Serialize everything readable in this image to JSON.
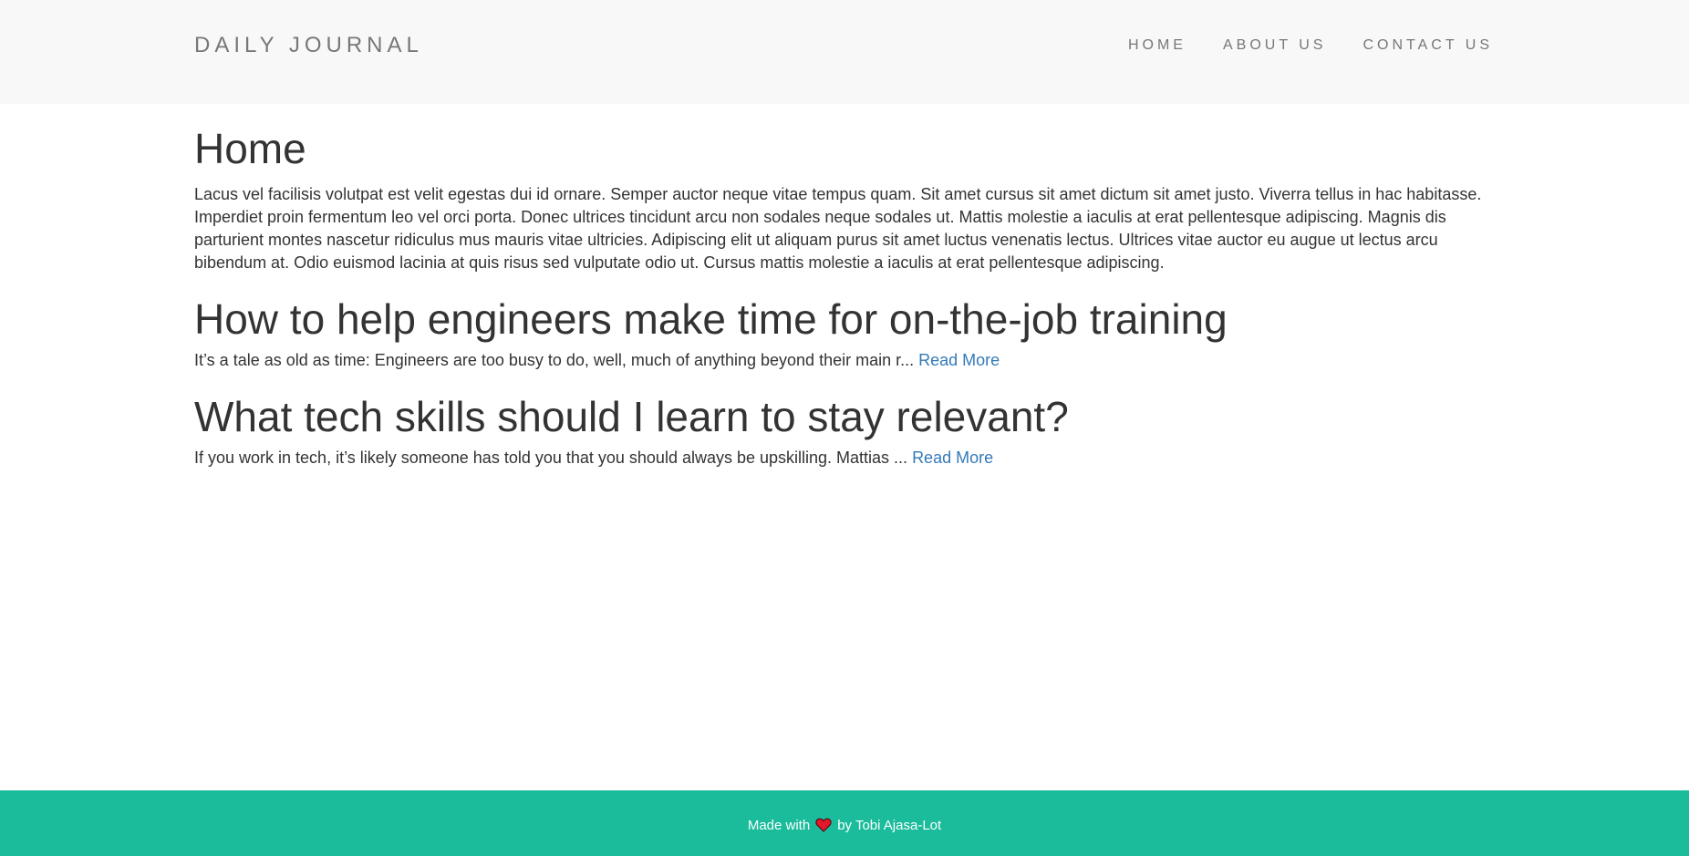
{
  "header": {
    "brand": "DAILY JOURNAL",
    "nav": [
      {
        "label": "HOME"
      },
      {
        "label": "ABOUT US"
      },
      {
        "label": "CONTACT US"
      }
    ]
  },
  "main": {
    "title": "Home",
    "intro": "Lacus vel facilisis volutpat est velit egestas dui id ornare. Semper auctor neque vitae tempus quam. Sit amet cursus sit amet dictum sit amet justo. Viverra tellus in hac habitasse. Imperdiet proin fermentum leo vel orci porta. Donec ultrices tincidunt arcu non sodales neque sodales ut. Mattis molestie a iaculis at erat pellentesque adipiscing. Magnis dis parturient montes nascetur ridiculus mus mauris vitae ultricies. Adipiscing elit ut aliquam purus sit amet luctus venenatis lectus. Ultrices vitae auctor eu augue ut lectus arcu bibendum at. Odio euismod lacinia at quis risus sed vulputate odio ut. Cursus mattis molestie a iaculis at erat pellentesque adipiscing.",
    "posts": [
      {
        "title": "How to help engineers make time for on-the-job training",
        "excerpt": "It’s a tale as old as time: Engineers are too busy to do, well, much of anything beyond their main r... ",
        "link_label": "Read More"
      },
      {
        "title": "What tech skills should I learn to stay relevant?",
        "excerpt": "If you work in tech, it’s likely someone has told you that you should always be upskilling. Mattias ... ",
        "link_label": "Read More"
      }
    ]
  },
  "footer": {
    "prefix": "Made with",
    "icon": "heart-icon",
    "suffix": "by Tobi Ajasa-Lot"
  },
  "colors": {
    "navbar_bg": "#f8f8f8",
    "footer_bg": "#1abc9c",
    "link": "#337ab7",
    "heart": "#e5172b"
  }
}
